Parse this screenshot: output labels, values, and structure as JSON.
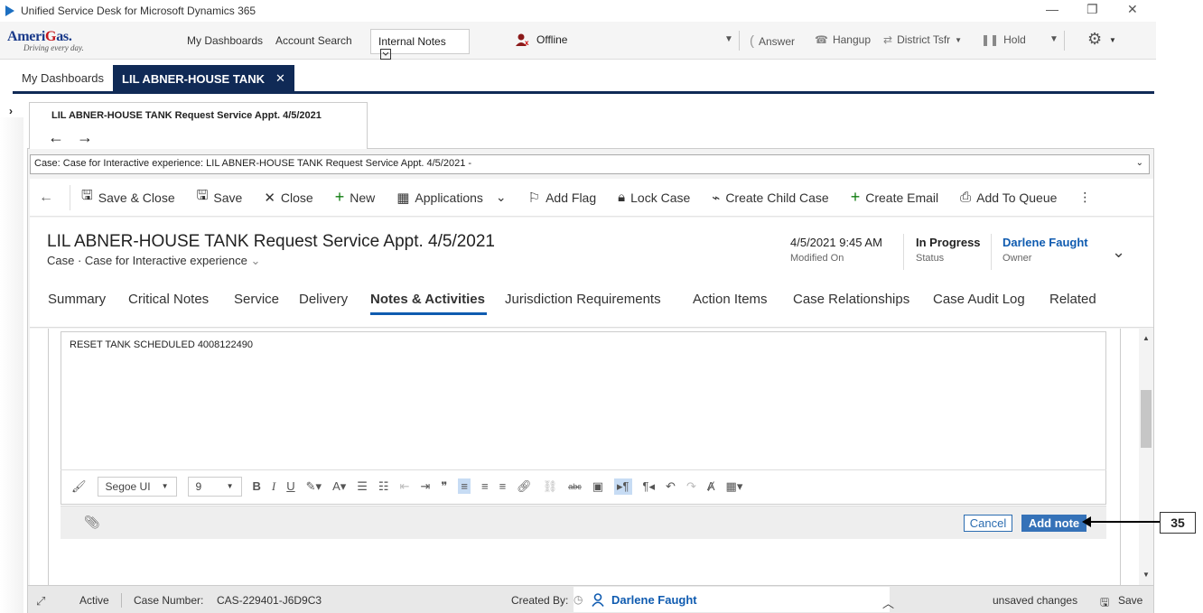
{
  "window": {
    "title": "Unified Service Desk for Microsoft Dynamics 365",
    "minimize": "—",
    "restore": "❐",
    "close": "✕"
  },
  "toolbar": {
    "brand_left": "Ameri",
    "brand_mid": "G",
    "brand_right": "as.",
    "tagline": "Driving every day.",
    "my_dashboards": "My Dashboards",
    "account_search": "Account Search",
    "internal_notes": "Internal Notes",
    "presence": "Offline",
    "answer": "Answer",
    "hangup": "Hangup",
    "district_tsfr": "District Tsfr",
    "hold": "Hold"
  },
  "session_tabs": {
    "dashboards": "My Dashboards",
    "active": "LIL ABNER-HOUSE TANK",
    "close": "✕"
  },
  "inner_tab": {
    "title": "LIL ABNER-HOUSE TANK  Request Service Appt. 4/5/2021"
  },
  "case_selector": "Case: Case for Interactive experience: LIL ABNER-HOUSE TANK Request Service Appt. 4/5/2021 -",
  "commands": {
    "save_close": "Save & Close",
    "save": "Save",
    "close": "Close",
    "new": "New",
    "applications": "Applications",
    "add_flag": "Add Flag",
    "lock_case": "Lock Case",
    "create_child_case": "Create Child Case",
    "create_email": "Create Email",
    "add_to_queue": "Add To Queue"
  },
  "record": {
    "title": "LIL ABNER-HOUSE TANK  Request Service Appt. 4/5/2021",
    "entity": "Case",
    "form": "Case for Interactive experience",
    "modified_on_value": "4/5/2021 9:45 AM",
    "modified_on_label": "Modified On",
    "status_value": "In Progress",
    "status_label": "Status",
    "owner_value": "Darlene Faught",
    "owner_label": "Owner"
  },
  "tabs": [
    "Summary",
    "Critical Notes",
    "Service",
    "Delivery",
    "Notes & Activities",
    "Jurisdiction Requirements",
    "Action Items",
    "Case Relationships",
    "Case Audit Log",
    "Related"
  ],
  "note": {
    "text": "RESET TANK SCHEDULED 4008122490",
    "font": "Segoe UI",
    "size": "9",
    "cancel": "Cancel",
    "add_note": "Add note"
  },
  "callout": "35",
  "footer": {
    "status": "Active",
    "case_number_label": "Case Number:",
    "case_number": "CAS-229401-J6D9C3",
    "created_by_label": "Created By:",
    "created_by": "Darlene Faught",
    "unsaved": "unsaved changes",
    "save": "Save"
  },
  "colors": {
    "session_tab": "#102a56",
    "link_blue": "#0f5bb0",
    "add_note_button": "#3572b8",
    "new_plus": "#107c10"
  }
}
